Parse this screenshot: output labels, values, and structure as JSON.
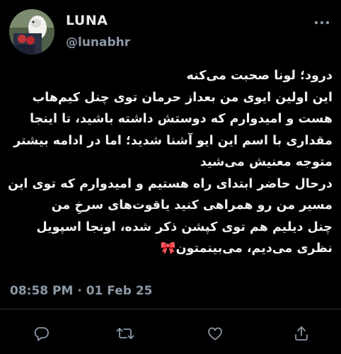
{
  "tweet": {
    "display_name": "LUNA",
    "handle": "@lunabhr",
    "lines": [
      "درود؛ لونا صحبت می‌کنه",
      "این اولین ایوی من بعداز حرمان توی چنل کیم‌هاب",
      "هست و امیدوارم که دوستش داشته باشید، تا اینجا",
      "مقداری با اسم این ایو آشنا شدید؛ اما در ادامه بیشتر",
      "متوجه معنیش می‌شید",
      "درحال حاضر ابتدای راه هستیم و امیدوارم که توی این",
      "مسیر من رو همراهی کنید یاقوت‌های سرخِ من",
      "چنل دیلیم هم توی کپشن ذکر شده، اونجا اسپویل",
      "نظری می‌دیم، می‌بینمتون🎀"
    ],
    "timestamp": "08:58 PM · 01 Feb 25"
  },
  "icons": {
    "more": "more-horizontal-icon",
    "reply": "reply-icon",
    "retweet": "retweet-icon",
    "like": "heart-icon",
    "share": "share-icon"
  },
  "colors": {
    "background": "#000000",
    "text": "#e7e9ea",
    "secondary": "#8b98a5",
    "divider": "#2f3336"
  }
}
